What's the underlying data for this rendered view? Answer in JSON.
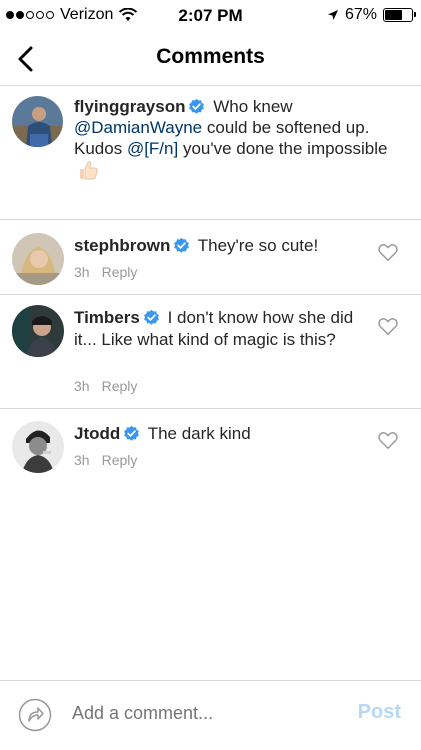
{
  "status_bar": {
    "carrier": "Verizon",
    "time": "2:07 PM",
    "battery": "67%",
    "battery_level": 0.67
  },
  "nav": {
    "title": "Comments"
  },
  "caption": {
    "username": "flyinggrayson",
    "text_before": "Who knew",
    "mention1": "@DamianWayne",
    "text_middle": "could be softened up. Kudos",
    "mention2": "@[F/n]",
    "text_after": "you've done the impossible"
  },
  "comments": [
    {
      "username": "stephbrown",
      "text": "They're so cute!",
      "time": "3h",
      "reply": "Reply"
    },
    {
      "username": "Timbers",
      "text": "I don't know how she did it... Like what kind of magic is this?",
      "time": "3h",
      "reply": "Reply"
    },
    {
      "username": "Jtodd",
      "text": "The dark kind",
      "time": "3h",
      "reply": "Reply"
    }
  ],
  "composer": {
    "placeholder": "Add a comment...",
    "post_label": "Post"
  },
  "colors": {
    "verified": "#3897f0",
    "mention": "#003569",
    "post_disabled": "#b5d9f6"
  }
}
